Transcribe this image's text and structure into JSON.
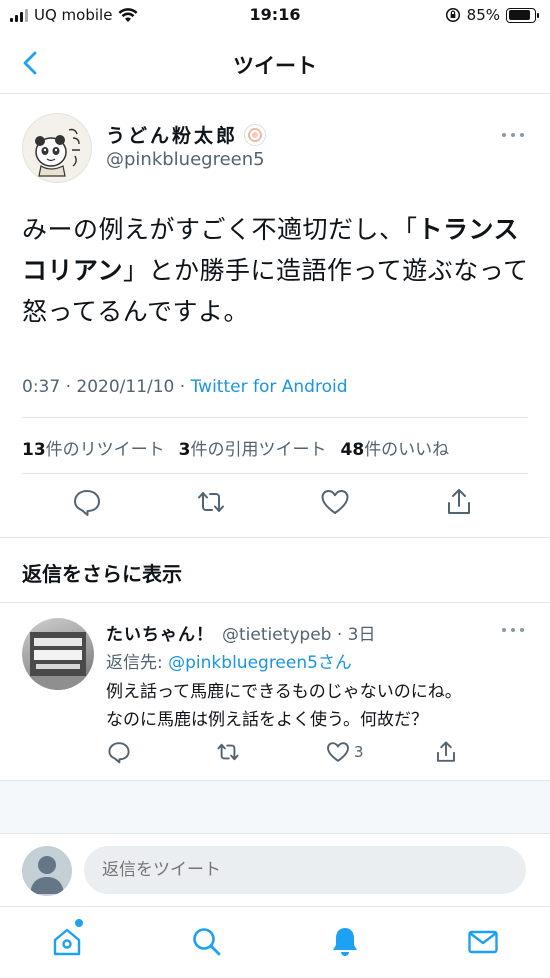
{
  "status_bar": {
    "carrier": "UQ mobile",
    "time": "19:16",
    "battery_percent": "85%",
    "battery_level": 0.85
  },
  "nav": {
    "title": "ツイート",
    "back_icon": "chevron-left-icon"
  },
  "tweet": {
    "author_name": "うどん粉太郎",
    "author_handle": "@pinkbluegreen5",
    "text_before": "みーの例えがすごく不適切だし、「",
    "text_bold": "トランスコリアン",
    "text_after": "」とか勝手に造語作って遊ぶなって怒ってるんですよ。",
    "time": "0:37 · 2020/11/10 · ",
    "source": "Twitter for Android",
    "stats": {
      "retweets_count": "13",
      "retweets_label": "件のリツイート",
      "quotes_count": "3",
      "quotes_label": "件の引用ツイート",
      "likes_count": "48",
      "likes_label": "件のいいね"
    }
  },
  "more_replies_label": "返信をさらに表示",
  "reply": {
    "name": "たいちゃん！",
    "handle_time": "@tietietypeb · 3日",
    "reply_to_prefix": "返信先: ",
    "reply_to_handle": "@pinkbluegreen5さん",
    "text_line1": "例え話って馬鹿にできるものじゃないのにね。",
    "text_line2": "なのに馬鹿は例え話をよく使う。何故だ？",
    "like_count": "3"
  },
  "compose": {
    "placeholder": "返信をツイート"
  },
  "tab_bar": [
    "home-icon",
    "search-icon",
    "notifications-icon",
    "messages-icon"
  ],
  "colors": {
    "accent": "#1da1f2",
    "link": "#1b95e0",
    "text_secondary": "#536471"
  }
}
